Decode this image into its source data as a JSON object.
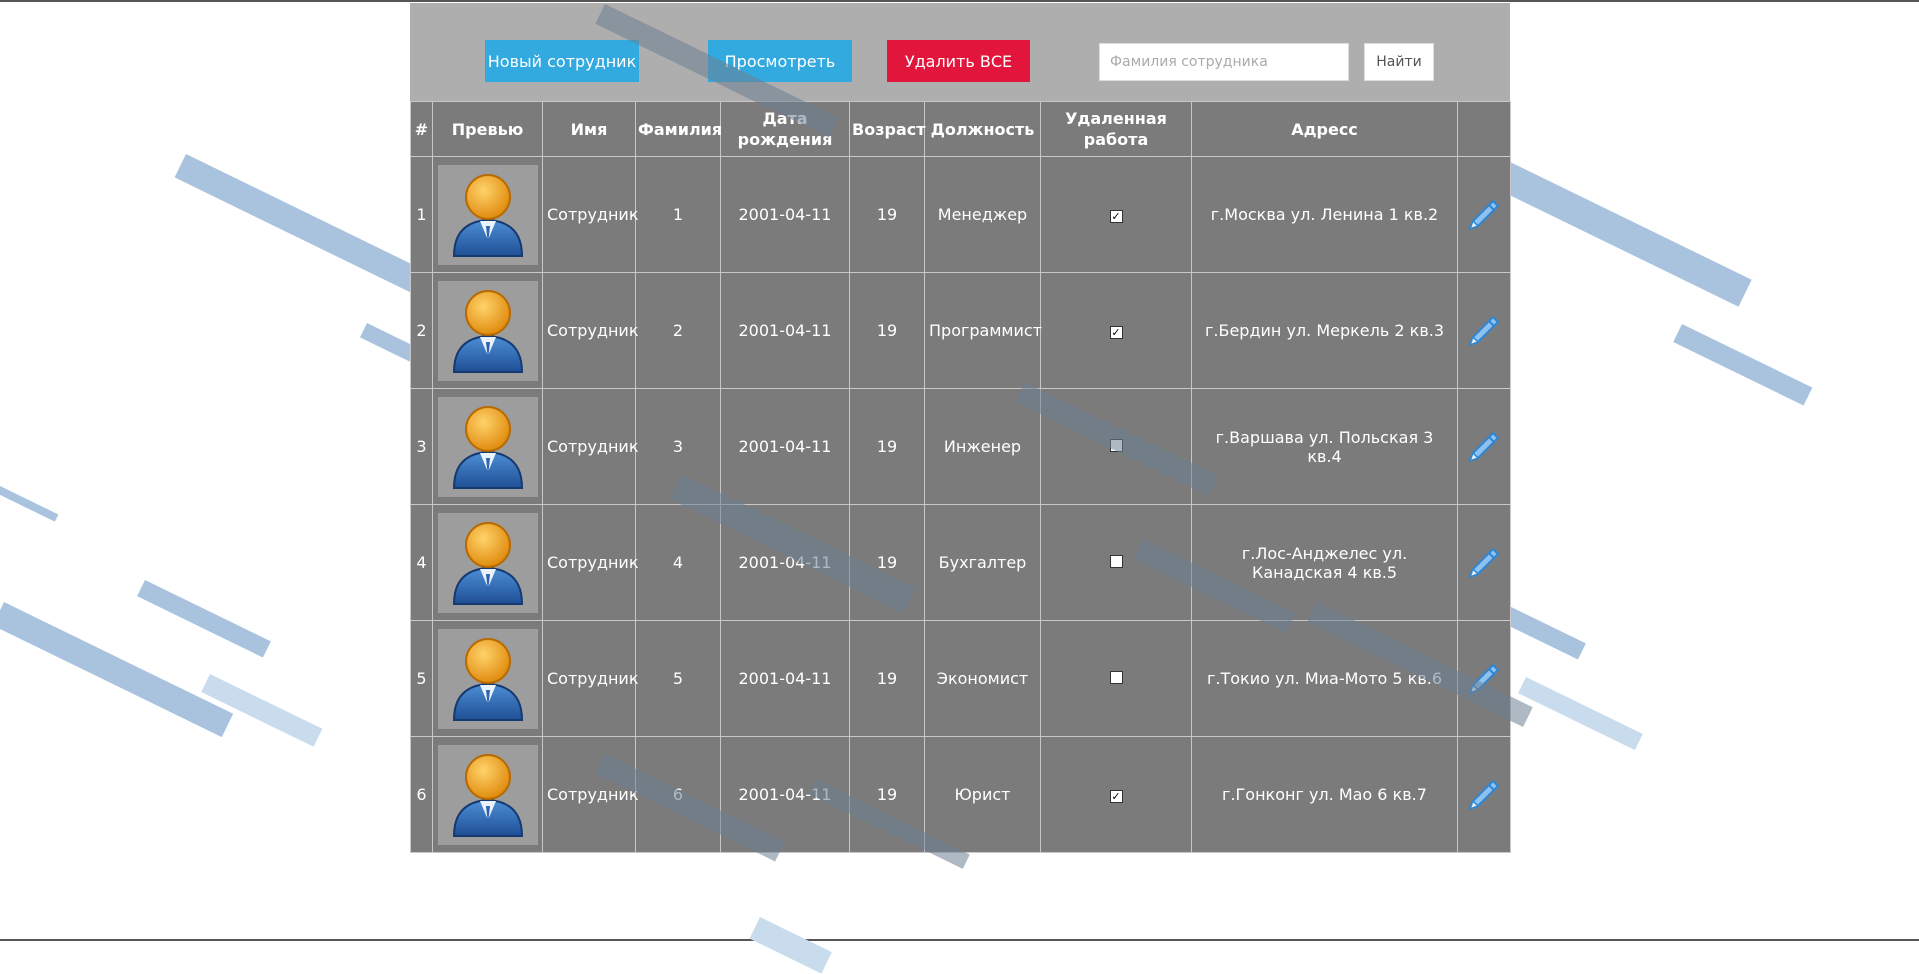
{
  "toolbar": {
    "new_employee_label": "Новый сотрудник",
    "view_label": "Просмотреть",
    "delete_all_label": "Удалить ВСЕ",
    "search_placeholder": "Фамилия сотрудника",
    "search_value": "",
    "find_label": "Найти"
  },
  "table": {
    "headers": {
      "num": "#",
      "preview": "Превью",
      "first_name": "Имя",
      "last_name": "Фамилия",
      "birth_date": "Дата рождения",
      "age": "Возраст",
      "position": "Должность",
      "remote": "Удаленная работа",
      "address": "Адресс"
    },
    "rows": [
      {
        "num": "1",
        "first_name": "Сотрудник",
        "last_name": "1",
        "birth_date": "2001-04-11",
        "age": "19",
        "position": "Менеджер",
        "remote": true,
        "address": "г.Москва ул. Ленина 1 кв.2"
      },
      {
        "num": "2",
        "first_name": "Сотрудник",
        "last_name": "2",
        "birth_date": "2001-04-11",
        "age": "19",
        "position": "Программист",
        "remote": true,
        "address": "г.Бердин ул. Меркель 2 кв.3"
      },
      {
        "num": "3",
        "first_name": "Сотрудник",
        "last_name": "3",
        "birth_date": "2001-04-11",
        "age": "19",
        "position": "Инженер",
        "remote": false,
        "address": "г.Варшава ул. Польская 3 кв.4"
      },
      {
        "num": "4",
        "first_name": "Сотрудник",
        "last_name": "4",
        "birth_date": "2001-04-11",
        "age": "19",
        "position": "Бухгалтер",
        "remote": false,
        "address": "г.Лос-Анджелес ул. Канадская 4 кв.5"
      },
      {
        "num": "5",
        "first_name": "Сотрудник",
        "last_name": "5",
        "birth_date": "2001-04-11",
        "age": "19",
        "position": "Экономист",
        "remote": false,
        "address": "г.Токио ул. Миа-Мото 5 кв.6"
      },
      {
        "num": "6",
        "first_name": "Сотрудник",
        "last_name": "6",
        "birth_date": "2001-04-11",
        "age": "19",
        "position": "Юрист",
        "remote": true,
        "address": "г.Гонконг ул. Мао 6 кв.7"
      }
    ]
  },
  "icons": {
    "preview": "user-avatar-icon",
    "edit": "pencil-icon"
  },
  "colors": {
    "primary_button": "#32a9df",
    "danger_button": "#e2163c",
    "panel_background": "#aeaeae",
    "table_background": "#7b7b7b"
  }
}
